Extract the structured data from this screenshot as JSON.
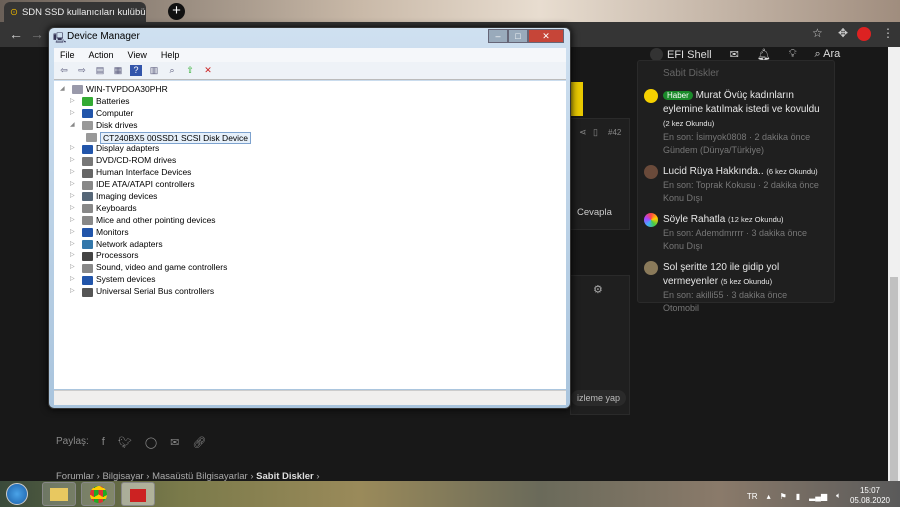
{
  "browser": {
    "tab_title": "SDN SSD kullanıcıları kulübü | Sa",
    "tab_close": "×",
    "new_tab": "+",
    "back": "←",
    "forward": "→"
  },
  "site_header": {
    "user": "EFI Shell",
    "search": "Ara"
  },
  "sidebar": {
    "prev_meta": "Sabit Diskler",
    "items": [
      {
        "badge": "Haber",
        "title": "Murat Övüç kadınların eylemine katılmak istedi ve kovuldu",
        "count": "(2 kez Okundu)",
        "meta": "En son: İsimyok0808 · 2 dakika önce",
        "forum": "Gündem (Dünya/Türkiye)",
        "color": "#f5d000"
      },
      {
        "title": "Lucid Rüya Hakkında..",
        "count": "(6 kez Okundu)",
        "meta": "En son: Toprak Kokusu · 2 dakika önce",
        "forum": "Konu Dışı",
        "color": "#6a4a3a"
      },
      {
        "title": "Söyle Rahatla",
        "count": "(12 kez Okundu)",
        "meta": "En son: Ademdmrrrr · 3 dakika önce",
        "forum": "Konu Dışı",
        "color": "#7a5ad0"
      },
      {
        "title": "Sol şeritte 120 ile gidip yol vermeyenler",
        "count": "(5 kez Okundu)",
        "meta": "En son: akilli55 · 3 dakika önce",
        "forum": "Otomobil",
        "color": "#8a7a5a"
      }
    ]
  },
  "post": {
    "number": "#42",
    "reply": "Cevapla",
    "preview": "izleme yap"
  },
  "share": {
    "label": "Paylaş:"
  },
  "breadcrumb": [
    "Forumlar",
    "Bilgisayar",
    "Masaüstü Bilgisayarlar",
    "Sabit Diskler"
  ],
  "device_manager": {
    "title": "Device Manager",
    "menu": [
      "File",
      "Action",
      "View",
      "Help"
    ],
    "root": "WIN-TVPDOA30PHR",
    "nodes": [
      "Batteries",
      "Computer",
      "Disk drives",
      "CT240BX5 00SSD1 SCSI Disk Device",
      "Display adapters",
      "DVD/CD-ROM drives",
      "Human Interface Devices",
      "IDE ATA/ATAPI controllers",
      "Imaging devices",
      "Keyboards",
      "Mice and other pointing devices",
      "Monitors",
      "Network adapters",
      "Processors",
      "Sound, video and game controllers",
      "System devices",
      "Universal Serial Bus controllers"
    ]
  },
  "taskbar": {
    "lang": "TR",
    "time": "15:07",
    "date": "05.08.2020"
  }
}
